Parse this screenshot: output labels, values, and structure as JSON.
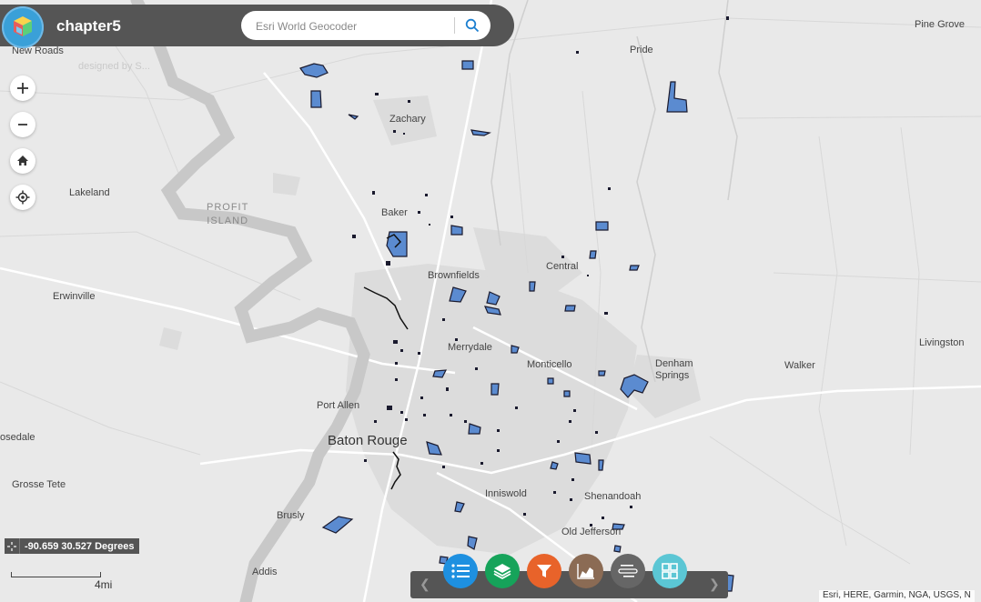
{
  "app": {
    "title": "chapter5"
  },
  "search": {
    "placeholder": "Esri World Geocoder"
  },
  "map_labels": {
    "new_roads": "New Roads",
    "pride": "Pride",
    "pine_grove": "Pine Grove",
    "zachary": "Zachary",
    "lakeland": "Lakeland",
    "profit_island_1": "PROFIT",
    "profit_island_2": "ISLAND",
    "baker": "Baker",
    "central": "Central",
    "brownfields": "Brownfields",
    "erwinville": "Erwinville",
    "merrydale": "Merrydale",
    "livingston": "Livingston",
    "monticello": "Monticello",
    "denham_1": "Denham",
    "denham_2": "Springs",
    "walker": "Walker",
    "port_allen": "Port Allen",
    "baton_rouge": "Baton Rouge",
    "rosedale": "osedale",
    "grosse_tete": "Grosse Tete",
    "inniswold": "Inniswold",
    "shenandoah": "Shenandoah",
    "brusly": "Brusly",
    "old_jefferson": "Old Jefferson",
    "addis": "Addis",
    "watermark": "designed by S..."
  },
  "coordinates": {
    "text": "-90.659 30.527 Degrees"
  },
  "scale": {
    "label": "4mi"
  },
  "attribution": "Esri, HERE, Garmin, NGA, USGS, N",
  "colors": {
    "header": "#555555",
    "polygon_fill": "#5b8bd0",
    "polygon_stroke": "#1a1a2e",
    "land": "#e9e9e9",
    "urban": "#dcdcdc",
    "water": "#c8c8c8",
    "widget_legend": "#1e90e0",
    "widget_layers": "#16a35a",
    "widget_filter": "#e8632a",
    "widget_chart": "#8b6b54",
    "widget_query": "#666666",
    "widget_grid": "#5bc6d4"
  },
  "icons": {
    "logo": "app-logo-icon",
    "search": "search-icon",
    "zoom_in": "plus-icon",
    "zoom_out": "minus-icon",
    "home": "home-icon",
    "locate": "locate-icon",
    "legend": "legend-list-icon",
    "layers": "layers-icon",
    "filter": "filter-icon",
    "chart": "chart-icon",
    "query": "query-icon",
    "grid": "grid-icon"
  }
}
